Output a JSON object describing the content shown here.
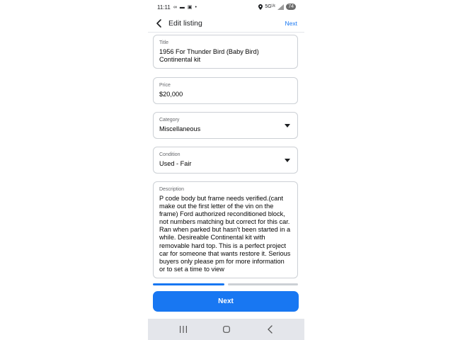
{
  "status_bar": {
    "time": "11:11",
    "left_icons": "∞ ▬ ▣ •",
    "network": "5Gᵁᶜ",
    "battery": "74"
  },
  "header": {
    "title": "Edit listing",
    "next_label": "Next"
  },
  "fields": {
    "title": {
      "label": "Title",
      "value": "1956 For Thunder Bird (Baby Bird)\nContinental kit"
    },
    "price": {
      "label": "Price",
      "value": "$20,000"
    },
    "category": {
      "label": "Category",
      "value": "Miscellaneous"
    },
    "condition": {
      "label": "Condition",
      "value": "Used - Fair"
    },
    "description": {
      "label": "Description",
      "value": "P code body but frame needs verified.(cant make out the first letter of the vin on the frame) Ford authorized reconditioned block, not numbers matching but correct for this car. Ran when parked but hasn't been started in a while. Desireable Continental kit with removable hard top. This is a perfect project car for someone that wants restore it.  Serious buyers only please pm for more information or to set a time to view"
    }
  },
  "progress": {
    "steps": 2,
    "current_step": 1,
    "active_color": "#1877f2",
    "inactive_color": "#ccd0d5"
  },
  "footer": {
    "next_button_label": "Next"
  },
  "nav": {
    "recents_icon": "recents-icon",
    "home_icon": "home-icon",
    "back_icon": "back-icon"
  },
  "colors": {
    "accent": "#1877f2",
    "nav_bar": "#e4e6eb"
  }
}
